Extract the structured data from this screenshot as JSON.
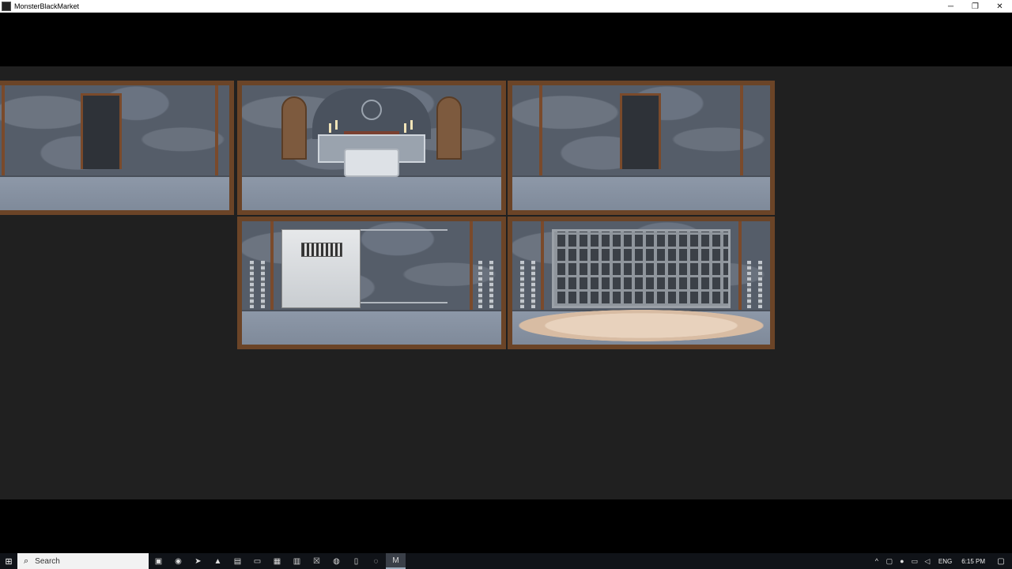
{
  "window": {
    "title": "MonsterBlackMarket",
    "controls": {
      "minimize": "─",
      "restore": "❐",
      "close": "✕"
    }
  },
  "game": {
    "rooms": [
      {
        "id": "corridor-left",
        "type": "corridor"
      },
      {
        "id": "chapel",
        "type": "chapel"
      },
      {
        "id": "corridor-right",
        "type": "corridor"
      },
      {
        "id": "cell",
        "type": "cell"
      },
      {
        "id": "cage",
        "type": "cage"
      }
    ]
  },
  "taskbar": {
    "start_icon": "windows-start-icon",
    "search_placeholder": "Search",
    "pinned": [
      "task-view-icon",
      "edge-icon",
      "telegram-icon",
      "store-icon",
      "photoshop-icon",
      "file-explorer-icon",
      "app-icon",
      "notepad-icon",
      "app-icon",
      "chrome-icon",
      "app-icon",
      "app-icon",
      "monster-black-market-icon"
    ],
    "tray": {
      "language": "ENG",
      "time": "6:15 PM"
    }
  }
}
